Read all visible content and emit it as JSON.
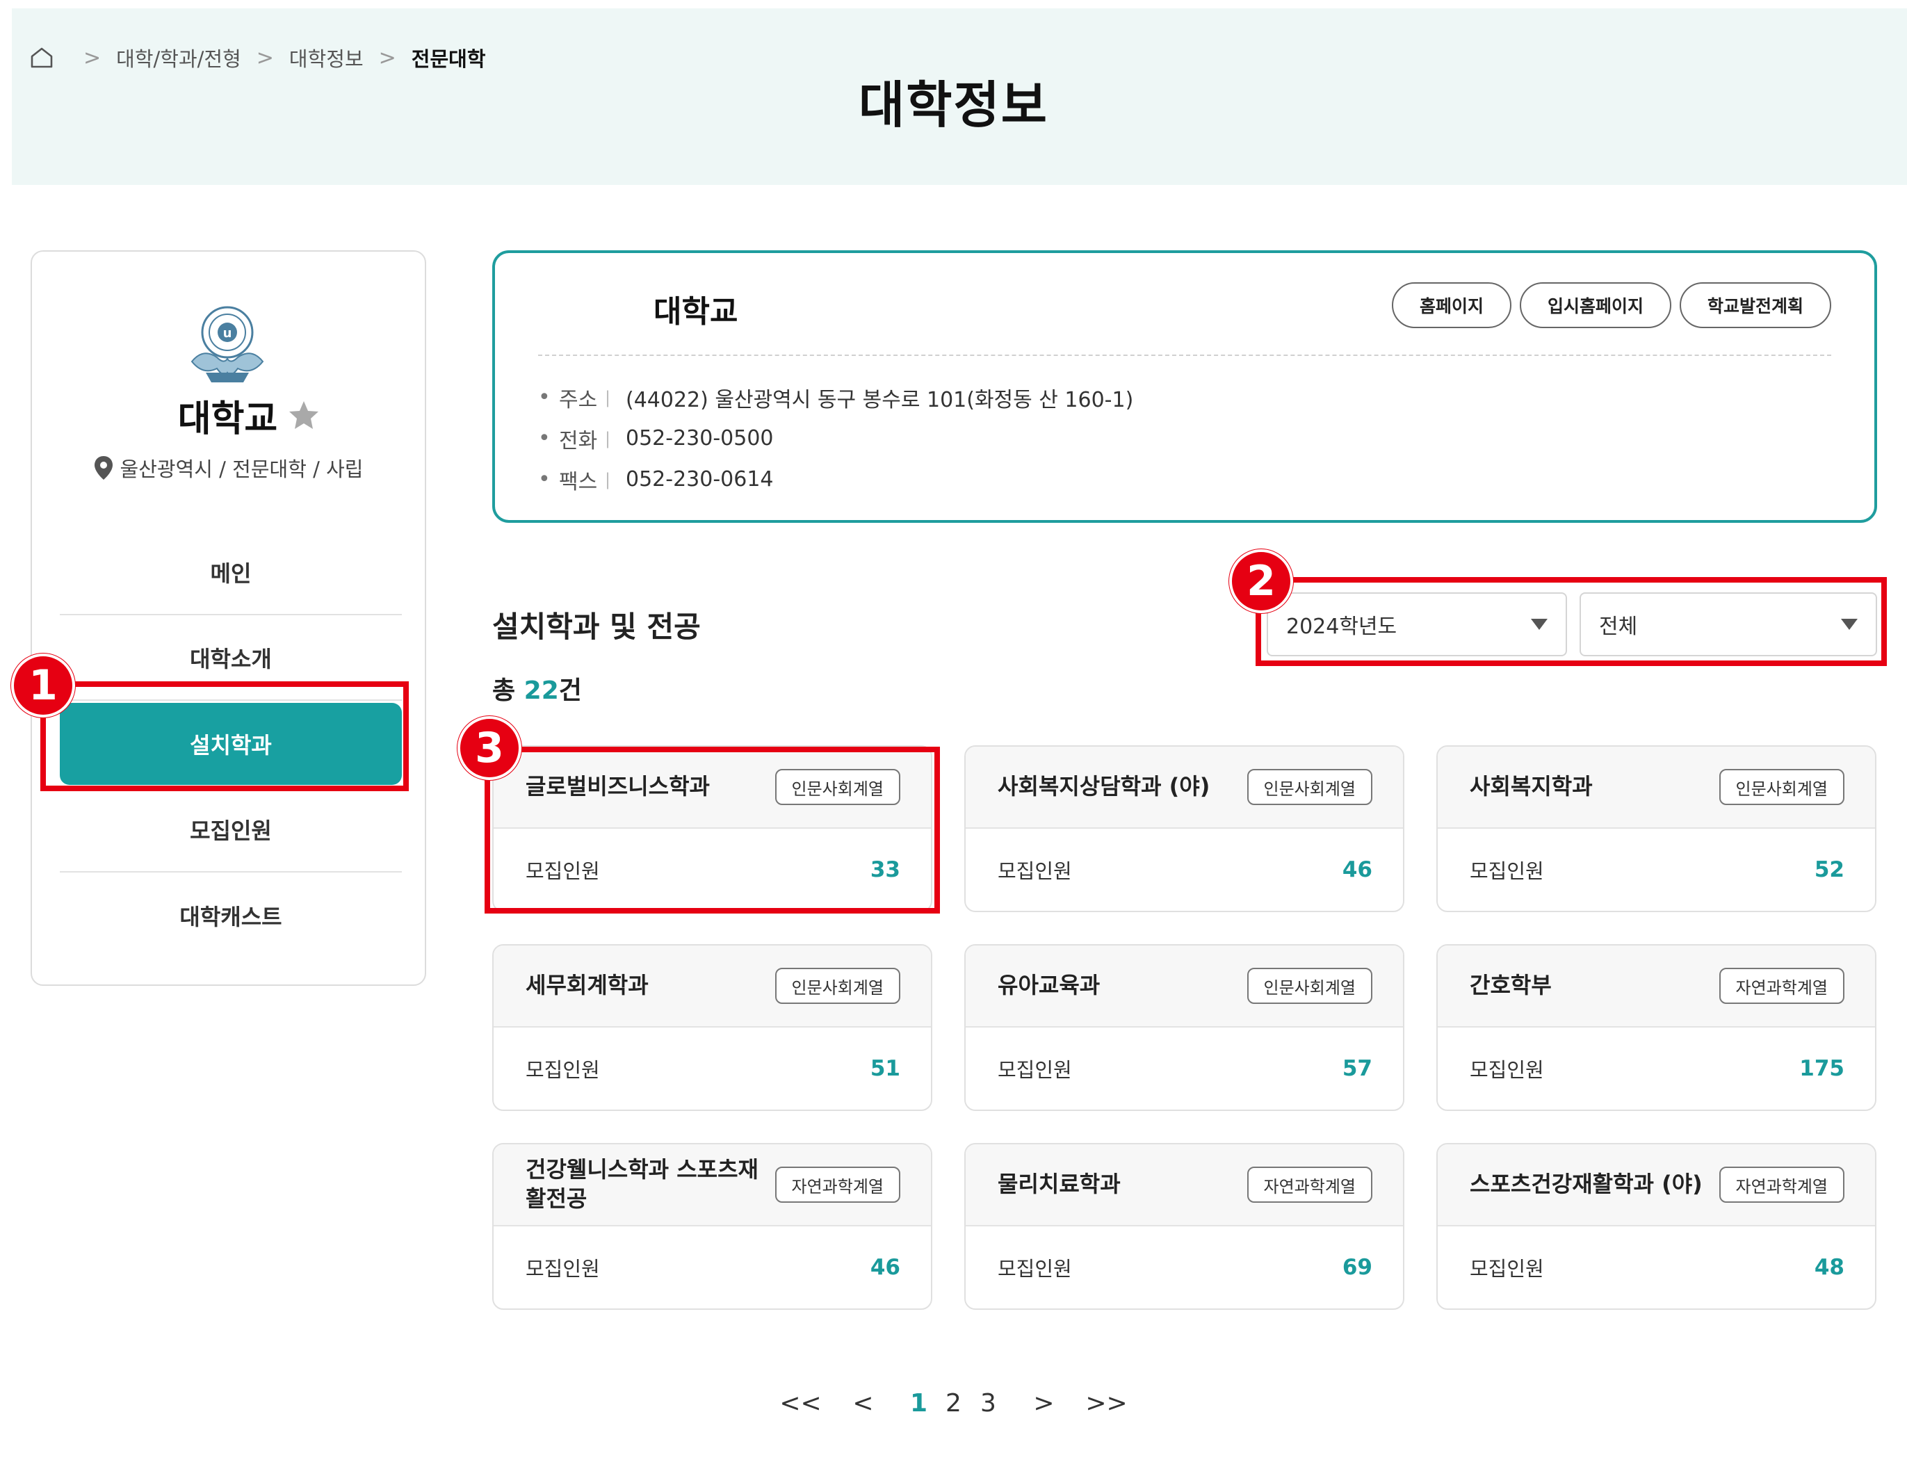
{
  "breadcrumb": {
    "items": [
      "대학/학과/전형",
      "대학정보"
    ],
    "current": "전문대학"
  },
  "page_title": "대학정보",
  "sidebar": {
    "university_name": "대학교",
    "location": "울산광역시 / 전문대학 / 사립",
    "menu": [
      {
        "label": "메인",
        "active": false
      },
      {
        "label": "대학소개",
        "active": false
      },
      {
        "label": "설치학과",
        "active": true
      },
      {
        "label": "모집인원",
        "active": false
      },
      {
        "label": "대학캐스트",
        "active": false
      }
    ]
  },
  "info": {
    "name": "대학교",
    "buttons": [
      "홈페이지",
      "입시홈페이지",
      "학교발전계획"
    ],
    "rows": [
      {
        "label": "주소",
        "value": "(44022) 울산광역시 동구 봉수로 101(화정동 산 160-1)"
      },
      {
        "label": "전화",
        "value": "052-230-0500"
      },
      {
        "label": "팩스",
        "value": "052-230-0614"
      }
    ]
  },
  "departments": {
    "title": "설치학과 및 전공",
    "total_prefix": "총",
    "total_count": "22",
    "total_suffix": "건",
    "year_select": "2024학년도",
    "category_select": "전체",
    "cards": [
      {
        "name": "글로벌비즈니스학과",
        "category": "인문사회계열",
        "label": "모집인원",
        "count": "33"
      },
      {
        "name": "사회복지상담학과 (야)",
        "category": "인문사회계열",
        "label": "모집인원",
        "count": "46"
      },
      {
        "name": "사회복지학과",
        "category": "인문사회계열",
        "label": "모집인원",
        "count": "52"
      },
      {
        "name": "세무회계학과",
        "category": "인문사회계열",
        "label": "모집인원",
        "count": "51"
      },
      {
        "name": "유아교육과",
        "category": "인문사회계열",
        "label": "모집인원",
        "count": "57"
      },
      {
        "name": "간호학부",
        "category": "자연과학계열",
        "label": "모집인원",
        "count": "175"
      },
      {
        "name": "건강웰니스학과 스포츠재활전공",
        "category": "자연과학계열",
        "label": "모집인원",
        "count": "46"
      },
      {
        "name": "물리치료학과",
        "category": "자연과학계열",
        "label": "모집인원",
        "count": "69"
      },
      {
        "name": "스포츠건강재활학과 (야)",
        "category": "자연과학계열",
        "label": "모집인원",
        "count": "48"
      }
    ]
  },
  "pagination": {
    "first": "<<",
    "prev": "<",
    "pages": [
      "1",
      "2",
      "3"
    ],
    "current": "1",
    "next": ">",
    "last": ">>"
  },
  "annotations": [
    "1",
    "2",
    "3"
  ],
  "colors": {
    "accent": "#18a0a1",
    "highlight": "#e60012",
    "banner": "#eef7f6"
  },
  "icons": {
    "home": "home-icon",
    "star": "star-icon",
    "pin": "location-pin-icon",
    "logo": "university-seal-logo"
  }
}
